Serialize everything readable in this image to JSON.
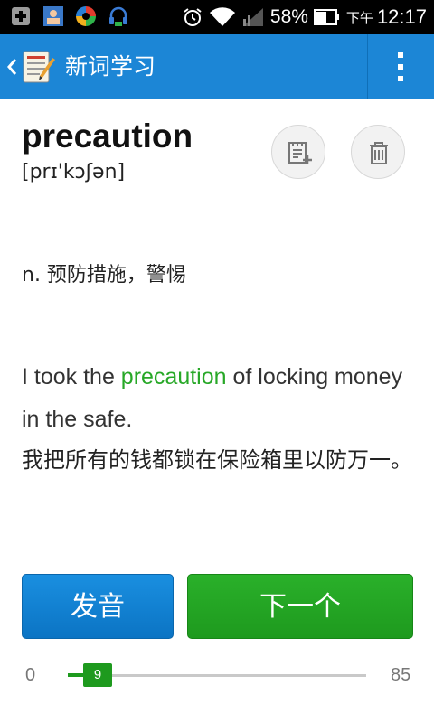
{
  "status_bar": {
    "battery": "58%",
    "ampm": "下午",
    "time": "12:17",
    "icons": [
      "notification-add-icon",
      "contact-card-icon",
      "app-swirl-icon",
      "headset-icon",
      "alarm-icon",
      "wifi-icon",
      "signal-icon",
      "battery-icon"
    ]
  },
  "action_bar": {
    "title": "新词学习",
    "color": "#1c86d6"
  },
  "card": {
    "word": "precaution",
    "phonetic": "[prɪ'kɔʃən]",
    "definition": "n. 预防措施，警惕",
    "example_before": "I took the ",
    "example_highlight": "precaution",
    "example_after": " of locking money in the safe.",
    "translation": "我把所有的钱都锁在保险箱里以防万一。",
    "highlight_color": "#28a828"
  },
  "buttons": {
    "speak": "发音",
    "next": "下一个",
    "speak_color": "#0b74c4",
    "next_color": "#1e9a1e"
  },
  "progress": {
    "min": "0",
    "max": "85",
    "current": "9"
  }
}
